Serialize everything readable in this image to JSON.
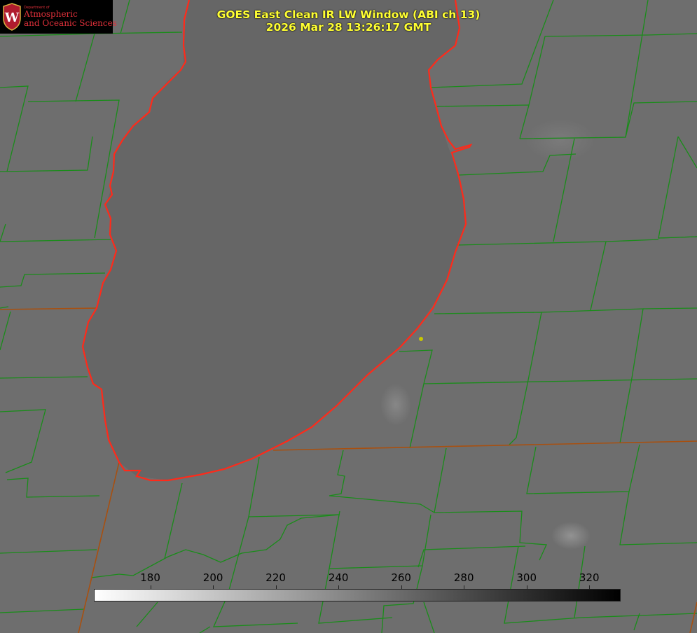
{
  "title": {
    "line1": "GOES East Clean IR LW Window (ABI ch 13)",
    "line2": "2026 Mar 28 13:26:17 GMT"
  },
  "logo": {
    "department": "Department of",
    "line1": "Atmospheric",
    "line2": "and Oceanic Sciences",
    "seal_letter": "W"
  },
  "colorbar": {
    "ticks": [
      "180",
      "200",
      "220",
      "240",
      "260",
      "280",
      "300",
      "320"
    ],
    "min": 162,
    "max": 330,
    "gradient": [
      "#ffffff",
      "#000000"
    ]
  },
  "colors": {
    "background": "#6e6e6e",
    "county_lines": "#1a8c1a",
    "lake_outline": "#ff2a1a",
    "state_lines": "#b04a10",
    "title_text": "#ffff33",
    "marker": "#c8c800"
  }
}
